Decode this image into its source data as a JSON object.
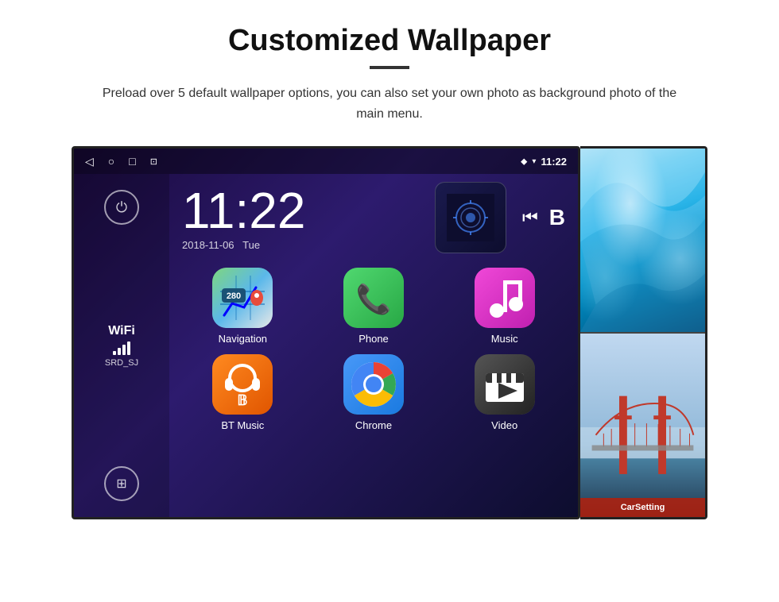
{
  "page": {
    "title": "Customized Wallpaper",
    "description": "Preload over 5 default wallpaper options, you can also set your own photo as background photo of the main menu.",
    "divider": true
  },
  "android_screen": {
    "status_bar": {
      "time": "11:22",
      "back_icon": "◁",
      "home_icon": "○",
      "recent_icon": "□",
      "screenshot_icon": "⊡",
      "location_icon": "📍",
      "wifi_icon": "▼",
      "signal_icon": "▼"
    },
    "clock": {
      "time": "11:22",
      "date": "2018-11-06",
      "day": "Tue"
    },
    "sidebar": {
      "power_label": "⏻",
      "wifi_label": "WiFi",
      "wifi_ssid": "SRD_SJ",
      "apps_icon": "⊞"
    },
    "apps": [
      {
        "name": "Navigation",
        "label": "Navigation",
        "icon_type": "navigation",
        "badge": "280"
      },
      {
        "name": "Phone",
        "label": "Phone",
        "icon_type": "phone"
      },
      {
        "name": "Music",
        "label": "Music",
        "icon_type": "music"
      },
      {
        "name": "BT Music",
        "label": "BT Music",
        "icon_type": "bt"
      },
      {
        "name": "Chrome",
        "label": "Chrome",
        "icon_type": "chrome"
      },
      {
        "name": "Video",
        "label": "Video",
        "icon_type": "video"
      }
    ],
    "wallpapers": [
      {
        "name": "glacier",
        "label": ""
      },
      {
        "name": "bridge",
        "label": "CarSetting"
      }
    ]
  },
  "colors": {
    "bg": "#ffffff",
    "android_bg": "#1a0a3e",
    "accent": "#4285f4"
  }
}
